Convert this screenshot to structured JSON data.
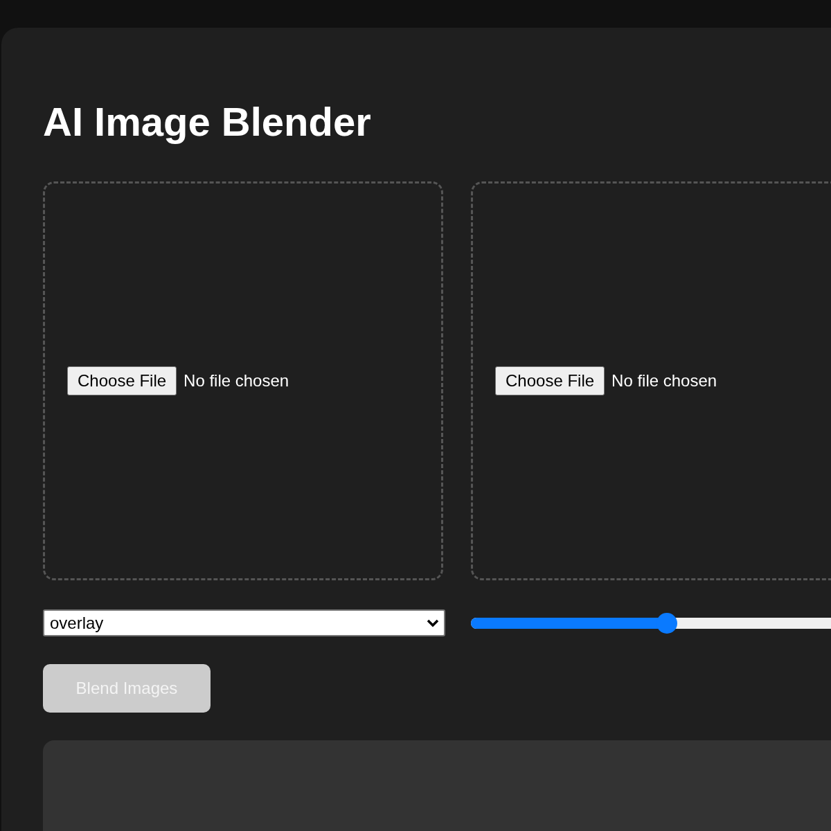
{
  "title": "AI Image Blender",
  "uploads": [
    {
      "button": "Choose File",
      "status": "No file chosen"
    },
    {
      "button": "Choose File",
      "status": "No file chosen"
    }
  ],
  "blend_mode": {
    "value": "overlay"
  },
  "opacity": {
    "level": 0.49
  },
  "blend_button": {
    "label": "Blend Images",
    "disabled": true
  },
  "result": {
    "kind": "empty"
  }
}
